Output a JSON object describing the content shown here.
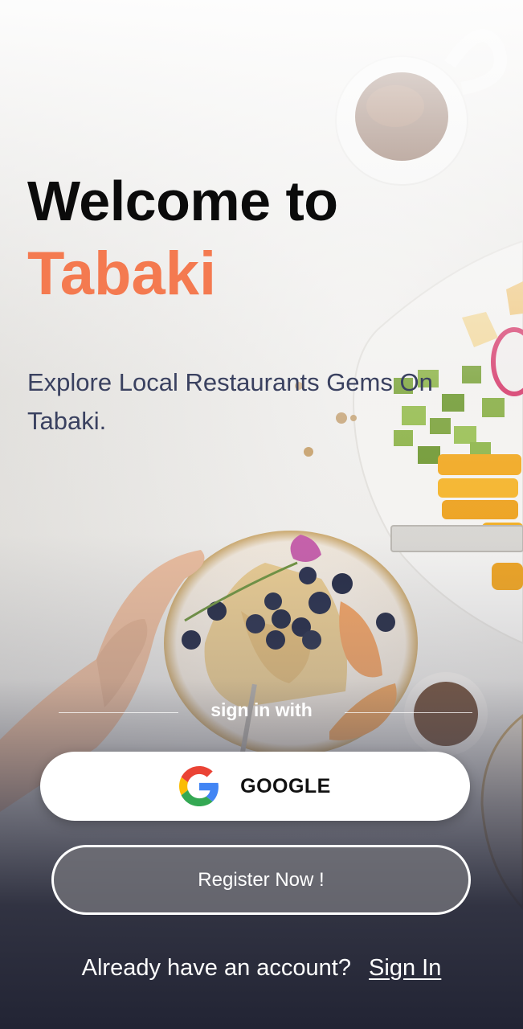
{
  "welcome": {
    "line1": "Welcome to",
    "brand": "Tabaki",
    "tagline": "Explore Local Restaurants Gems On Tabaki."
  },
  "signin": {
    "divider_label": "sign in with",
    "google_label": "GOOGLE",
    "google_icon": "google-g-logo",
    "register_label": "Register Now !"
  },
  "footer": {
    "prompt": "Already have an account?",
    "link": "Sign In"
  },
  "colors": {
    "brand": "#f47a50",
    "heading": "#0b0b0b",
    "tagline": "#3a4160",
    "bottom_dark": "#222434"
  }
}
